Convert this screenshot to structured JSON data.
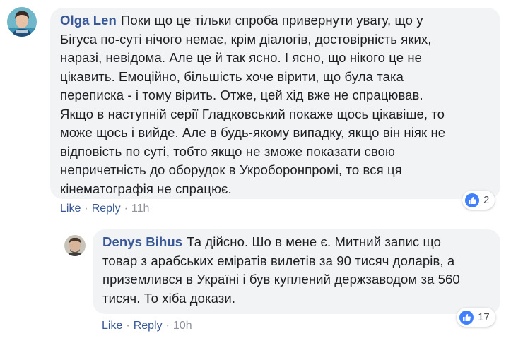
{
  "comment": {
    "author": "Olga Len",
    "lines": [
      "Поки що це тільки спроба привернути увагу, що у",
      "Бігуса по-суті нічого немає, крім діалогів, достовірність яких,",
      "наразі, невідома. Але це й так ясно. І ясно, що нікого це не",
      "цікавить. Емоційно, більшість хоче вірити, що була така",
      "переписка - і тому вірить. Отже, цей хід вже не спрацював.",
      "Якщо в наступній серії Гладковський покаже щось цікавіше, то",
      "може щось і вийде. Але в будь-якому випадку, якщо він ніяк не",
      "відповість по суті, тобто якщо не зможе показати свою",
      "непричетність до оборудок в Укроборонпромі, то вся ця",
      "кінематографія не спрацює."
    ],
    "reaction_count": "2",
    "like_label": "Like",
    "reply_label": "Reply",
    "time": "11h"
  },
  "reply": {
    "author": "Denys Bihus",
    "lines": [
      "Та дійсно. Шо в мене є. Митний запис що",
      "товар з арабських еміратів вилетів за 90 тисяч доларів, а",
      "приземлився в Україні і був куплений держзаводом за 560",
      "тисяч. То хіба докази."
    ],
    "reaction_count": "17",
    "like_label": "Like",
    "reply_label": "Reply",
    "time": "10h"
  },
  "colors": {
    "link": "#385898",
    "bubble": "#f2f3f5",
    "like_blue": "#4080ff",
    "meta": "#90949c"
  },
  "icons": {
    "reaction": "like-thumb-icon"
  }
}
